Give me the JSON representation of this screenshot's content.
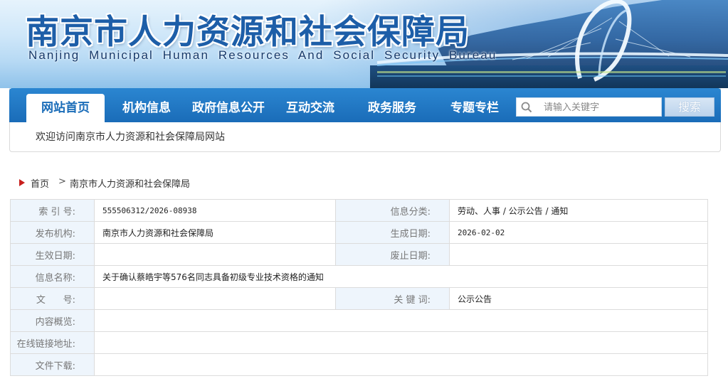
{
  "header": {
    "title_cn": "南京市人力资源和社会保障局",
    "title_en": "Nanjing Municipal Human Resources And Social Security Bureau"
  },
  "nav": {
    "items": [
      {
        "label": "网站首页",
        "active": true
      },
      {
        "label": "机构信息",
        "active": false
      },
      {
        "label": "政府信息公开",
        "active": false
      },
      {
        "label": "互动交流",
        "active": false
      },
      {
        "label": "政务服务",
        "active": false
      },
      {
        "label": "专题专栏",
        "active": false
      }
    ],
    "search_placeholder": "请输入关键字",
    "search_button": "搜索",
    "welcome": "欢迎访问南京市人力资源和社会保障局网站"
  },
  "breadcrumb": {
    "home": "首页",
    "separator": ">",
    "current": "南京市人力资源和社会保障局"
  },
  "info": {
    "index_no_label": "索 引 号:",
    "index_no": "555506312/2026-08938",
    "category_label": "信息分类:",
    "category": "劳动、人事 / 公示公告 / 通知",
    "publisher_label": "发布机构:",
    "publisher": "南京市人力资源和社会保障局",
    "created_label": "生成日期:",
    "created": "2026-02-02",
    "effective_label": "生效日期:",
    "effective": "",
    "repeal_label": "废止日期:",
    "repeal": "",
    "name_label": "信息名称:",
    "name": "关于确认蔡皓宇等576名同志具备初级专业技术资格的通知",
    "doc_no_label": "文      号:",
    "doc_no": "",
    "keywords_label": "关 键 词:",
    "keywords": "公示公告",
    "summary_label": "内容概览:",
    "summary": "",
    "link_label": "在线链接地址:",
    "link": "",
    "download_label": "文件下载:",
    "download": ""
  },
  "colors": {
    "nav_blue": "#1a6cb8",
    "label_bg": "#eef5fc",
    "title_blue": "#1d5ea8",
    "home_icon_red": "#c8201e"
  }
}
